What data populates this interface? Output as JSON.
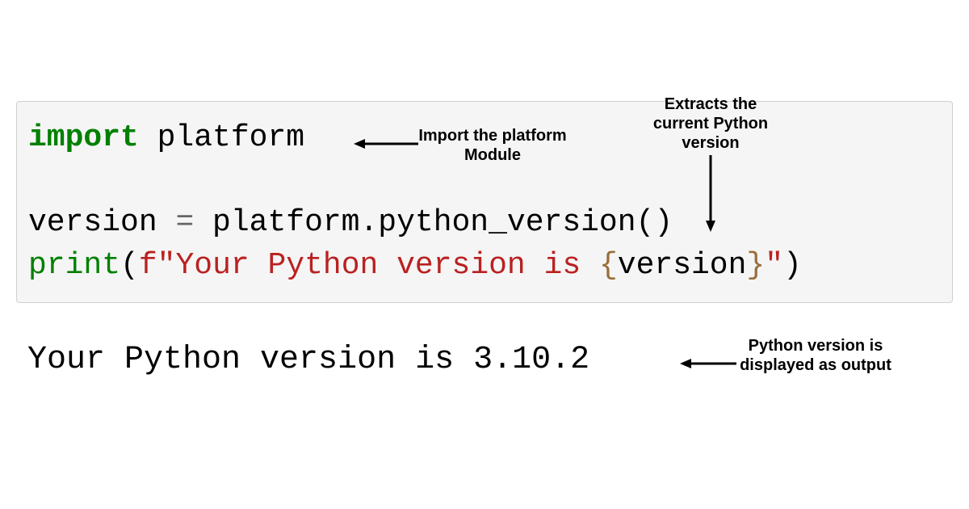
{
  "code": {
    "line1": {
      "import": "import",
      "module": " platform"
    },
    "line2": {
      "var": "version ",
      "eq": "=",
      "expr": " platform.python_version()"
    },
    "line3": {
      "print": "print",
      "open": "(",
      "fprefix": "f",
      "q1": "\"",
      "str1": "Your Python version is ",
      "ob": "{",
      "ivar": "version",
      "cb": "}",
      "q2": "\"",
      "close": ")"
    }
  },
  "output": "Your Python version is 3.10.2",
  "annotations": {
    "a1": "Import the platform Module",
    "a2": "Extracts the current Python version",
    "a3": "Python version is displayed as output"
  }
}
